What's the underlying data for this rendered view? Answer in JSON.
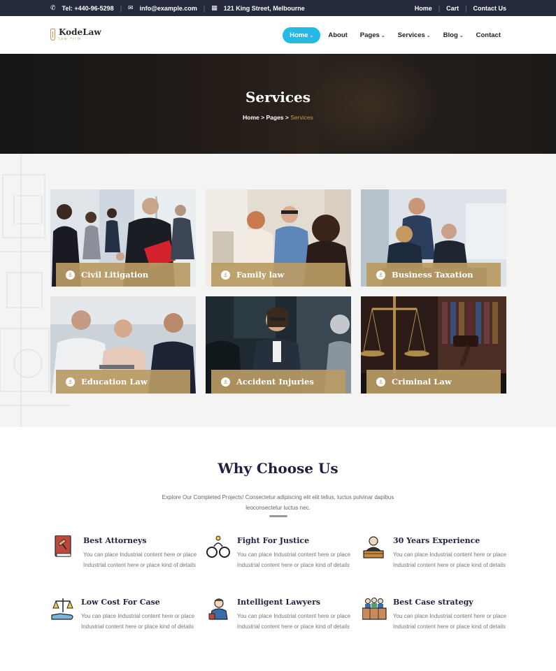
{
  "topbar": {
    "phone": "Tel: +440-96-5298",
    "email": "info@example.com",
    "address": "121 King Street, Melbourne",
    "links": [
      "Home",
      "Cart",
      "Contact Us"
    ]
  },
  "header": {
    "logo_text": "KodeLaw",
    "logo_sub": "law firm",
    "nav": [
      {
        "label": "Home",
        "caret": "⌄"
      },
      {
        "label": "About",
        "caret": ""
      },
      {
        "label": "Pages",
        "caret": "⌄"
      },
      {
        "label": "Services",
        "caret": "⌄"
      },
      {
        "label": "Blog",
        "caret": "⌄"
      },
      {
        "label": "Contact",
        "caret": ""
      }
    ]
  },
  "hero": {
    "title": "Services",
    "breadcrumb": {
      "home": "Home",
      "sep1": " > ",
      "pages": "Pages",
      "sep2": " > ",
      "current": "Services"
    }
  },
  "services": [
    {
      "label": "Civil Litigation",
      "icon": "anchor-icon"
    },
    {
      "label": "Family law",
      "icon": "anchor-icon"
    },
    {
      "label": "Business Taxation",
      "icon": "anchor-icon"
    },
    {
      "label": "Education Law",
      "icon": "anchor-icon"
    },
    {
      "label": "Accident Injuries",
      "icon": "anchor-icon"
    },
    {
      "label": "Criminal Law",
      "icon": "anchor-icon"
    }
  ],
  "why": {
    "title": "Why Choose Us",
    "desc_line1": "Explore Our Completed Projects! Consectetur adipiscing elit elit tellus, luctus pulvinar dapibus",
    "desc_line2": "leoconsectetur luctus nec.",
    "features": [
      {
        "title": "Best Attorneys",
        "icon": "law-book-icon",
        "text": "You can place Industrial content here or place Industrial content here or place kind of details"
      },
      {
        "title": "Fight For Justice",
        "icon": "handcuffs-icon",
        "text": "You can place Industrial content here or place Industrial content here or place kind of details"
      },
      {
        "title": "30 Years Experience",
        "icon": "judge-icon",
        "text": "You can place Industrial content here or place Industrial content here or place kind of details"
      },
      {
        "title": "Low Cost For Case",
        "icon": "scales-hand-icon",
        "text": "You can place Industrial content here or place Industrial content here or place kind of details"
      },
      {
        "title": "Intelligent Lawyers",
        "icon": "lawyer-icon",
        "text": "You can place Industrial content here or place Industrial content here or place kind of details"
      },
      {
        "title": "Best Case strategy",
        "icon": "jury-icon",
        "text": "You can place Industrial content here or place Industrial content here or place kind of details"
      }
    ]
  },
  "colors": {
    "topbar": "#252a3d",
    "accent_blue": "#25b9e6",
    "gold": "#b99b64",
    "heading": "#1e2240"
  }
}
